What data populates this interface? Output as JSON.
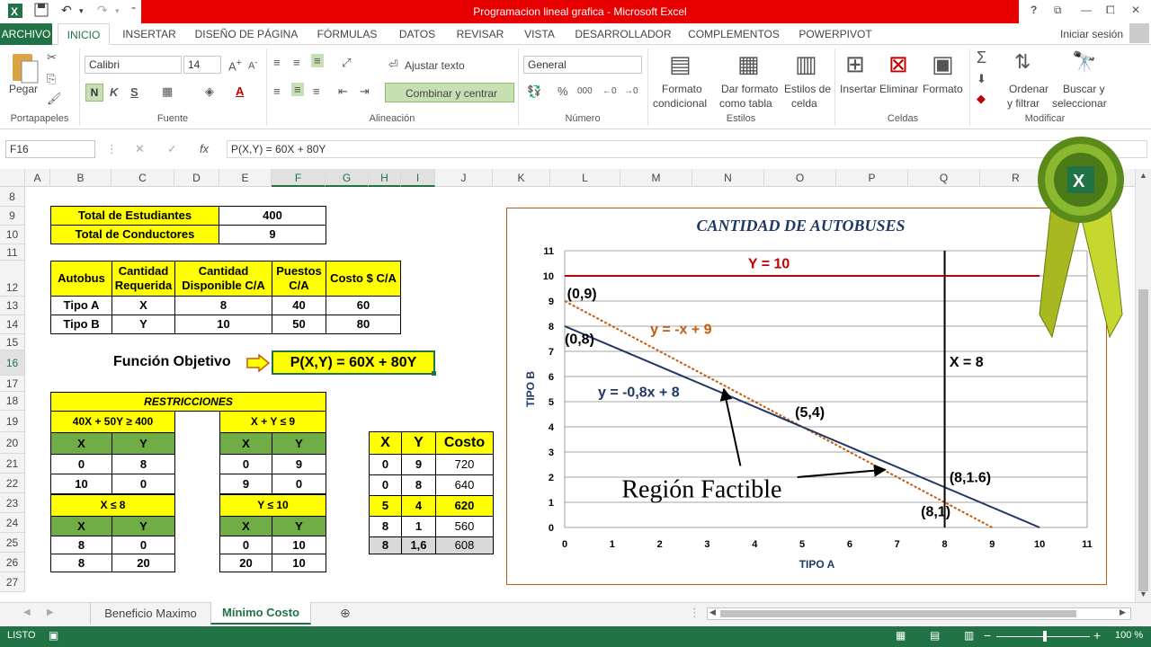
{
  "window": {
    "title": "Programacion lineal grafica - Microsoft Excel",
    "help": "?",
    "controls": [
      "⧉",
      "—",
      "⧠",
      "✕"
    ]
  },
  "ribbon_tabs": [
    "ARCHIVO",
    "INICIO",
    "INSERTAR",
    "DISEÑO DE PÁGINA",
    "FÓRMULAS",
    "DATOS",
    "REVISAR",
    "VISTA",
    "DESARROLLADOR",
    "COMPLEMENTOS",
    "POWERPIVOT"
  ],
  "signin": "Iniciar sesión",
  "ribbon": {
    "paste": "Pegar",
    "portapapeles": "Portapapeles",
    "font_name": "Calibri",
    "font_size": "14",
    "fuente": "Fuente",
    "wrap_text": "Ajustar texto",
    "merge_center": "Combinar y centrar",
    "alineacion": "Alineación",
    "number_format": "General",
    "numero": "Número",
    "cond_format_1": "Formato",
    "cond_format_2": "condicional",
    "table_format_1": "Dar formato",
    "table_format_2": "como tabla",
    "cell_styles_1": "Estilos de",
    "cell_styles_2": "celda",
    "estilos": "Estilos",
    "insert": "Insertar",
    "delete": "Eliminar",
    "format": "Formato",
    "celdas": "Celdas",
    "sort_1": "Ordenar",
    "sort_2": "y filtrar",
    "find_1": "Buscar y",
    "find_2": "seleccionar",
    "modificar": "Modificar",
    "bold": "N",
    "italic": "K",
    "underline": "S"
  },
  "formula_bar": {
    "name_box": "F16",
    "fx": "fx",
    "formula": "P(X,Y) = 60X + 80Y"
  },
  "columns": [
    "A",
    "B",
    "C",
    "D",
    "E",
    "F",
    "G",
    "H",
    "I",
    "J",
    "K",
    "L",
    "M",
    "N",
    "O",
    "P",
    "Q",
    "R"
  ],
  "rows": [
    "8",
    "9",
    "10",
    "11",
    "12",
    "13",
    "14",
    "15",
    "16",
    "17",
    "18",
    "19",
    "20",
    "21",
    "22",
    "23",
    "24",
    "25",
    "26",
    "27"
  ],
  "cells": {
    "total_est_label": "Total de Estudiantes",
    "total_est": "400",
    "total_cond_label": "Total de Conductores",
    "total_cond": "9",
    "h_autobus": "Autobus",
    "h_cant_req": "Cantidad Requerida",
    "h_cant_disp": "Cantidad Disponible C/A",
    "h_puestos": "Puestos C/A",
    "h_costo": "Costo $ C/A",
    "tipoA": [
      "Tipo A",
      "X",
      "8",
      "40",
      "60"
    ],
    "tipoB": [
      "Tipo B",
      "Y",
      "10",
      "50",
      "80"
    ],
    "fo_label": "Función Objetivo",
    "fo": "P(X,Y) = 60X + 80Y",
    "restricciones": "RESTRICCIONES",
    "r1": "40X + 50Y ≥ 400",
    "r2": "X + Y ≤ 9",
    "r3": "X ≤ 8",
    "r4": "Y ≤ 10",
    "x": "X",
    "yv": "Y",
    "r1_rows": [
      [
        "0",
        "8"
      ],
      [
        "10",
        "0"
      ]
    ],
    "r2_rows": [
      [
        "0",
        "9"
      ],
      [
        "9",
        "0"
      ]
    ],
    "r3_rows": [
      [
        "8",
        "0"
      ],
      [
        "8",
        "20"
      ]
    ],
    "r4_rows": [
      [
        "0",
        "10"
      ],
      [
        "20",
        "10"
      ]
    ],
    "cost_header": [
      "X",
      "Y",
      "Costo"
    ],
    "cost_rows": [
      [
        "0",
        "9",
        "720"
      ],
      [
        "0",
        "8",
        "640"
      ],
      [
        "5",
        "4",
        "620"
      ],
      [
        "8",
        "1",
        "560"
      ],
      [
        "8",
        "1,6",
        "608"
      ]
    ]
  },
  "chart_data": {
    "type": "line",
    "title": "CANTIDAD DE AUTOBUSES",
    "xlabel": "TIPO A",
    "ylabel": "TIPO B",
    "xlim": [
      0,
      11
    ],
    "ylim": [
      0,
      11
    ],
    "xticks": [
      "0",
      "1",
      "2",
      "3",
      "4",
      "5",
      "6",
      "7",
      "8",
      "9",
      "10",
      "11"
    ],
    "yticks": [
      "0",
      "1",
      "2",
      "3",
      "4",
      "5",
      "6",
      "7",
      "8",
      "9",
      "10",
      "11"
    ],
    "grid": true,
    "series": [
      {
        "name": "Y = 10",
        "color": "#c00000",
        "points": [
          [
            0,
            10
          ],
          [
            10,
            10
          ]
        ]
      },
      {
        "name": "y = -x + 9",
        "color": "#c55a11",
        "points": [
          [
            0,
            9
          ],
          [
            9,
            0
          ]
        ]
      },
      {
        "name": "y = -0,8x + 8",
        "color": "#1f3864",
        "points": [
          [
            0,
            8
          ],
          [
            10,
            0
          ]
        ]
      },
      {
        "name": "X = 8",
        "color": "#000000",
        "points": [
          [
            8,
            0
          ],
          [
            8,
            11
          ]
        ]
      }
    ],
    "point_labels": [
      "(0,9)",
      "(0,8)",
      "(5,4)",
      "(8,1.6)",
      "(8,1)"
    ],
    "annotation": "Región Factible"
  },
  "sheets": [
    "Beneficio Maximo",
    "Mínimo Costo"
  ],
  "status": {
    "ready": "LISTO",
    "zoom": "100 %"
  }
}
